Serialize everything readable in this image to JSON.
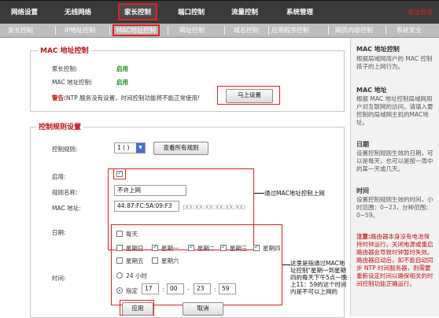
{
  "top_nav": {
    "items": [
      "网络设置",
      "无线网络",
      "家长控制",
      "端口控制",
      "流量控制",
      "系统管理"
    ],
    "logout": "退出登录"
  },
  "sub_nav": {
    "items": [
      "家长控制",
      "IP地址控制",
      "MAC地址控制",
      "网址控制",
      "域名控制",
      "应用程序控制",
      "网页内容控制",
      "系统安全"
    ]
  },
  "mac_section": {
    "legend": "MAC 地址控制",
    "parental_label": "家长控制:",
    "parental_value": "启用",
    "mac_label": "MAC 地址控制:",
    "mac_value": "启用",
    "warning_prefix": "警告:",
    "warning_text": "NTP 服务没有设置，时间控制功能将不能正常使用!",
    "setup_button": "马上设置"
  },
  "rule_section": {
    "legend": "控制规则设置",
    "rule_label": "控制规则:",
    "rule_select": "1 ( )",
    "view_all_button": "查看所有规则",
    "enable_label": "启用:",
    "name_label": "规则名称:",
    "name_value": "不许上网",
    "mac_addr_label": "MAC 地址:",
    "mac_addr_value": "44:87:FC:5A:09:F3",
    "mac_hint": "(XX:XX:XX:XX:XX:XX)",
    "date_label": "日期:",
    "every_day": "每天",
    "days": [
      "星期日",
      "星期一",
      "星期二",
      "星期三",
      "星期四",
      "星期五",
      "星期六"
    ],
    "time_label": "时间:",
    "hours24": "24 小时",
    "specify": "指定",
    "time_from_h": "17",
    "time_from_m": "00",
    "time_to_h": "23",
    "time_to_m": "59",
    "apply_button": "应用",
    "cancel_button": "取消"
  },
  "annotations": {
    "mac_note": "通过MAC地址控制上网",
    "time_note": "这里是指通过MAC地址控制\"星期一到星期四的每天下午5点一晚上11：59的这个时间内是不可以上网的"
  },
  "sidebar": {
    "mac_title": "MAC 地址控制",
    "mac_desc": "根据局域网用户的 MAC 控制孩子的上网行为。",
    "addr_title": "MAC 地址",
    "addr_desc": "根据 MAC 地址控制局域网用户对互联网的访问。请填入要控制的局域网主机的MAC地址。",
    "date_title": "日期",
    "date_desc": "设置控制规则生效的日期，可以是每天，也可以是按一周中的某一天或几天。",
    "time_title": "时间",
    "time_desc": "设置控制规则生效的时间，小时范围：0~23，分种范围：0~59。",
    "note_prefix": "注意:",
    "note_text": "路由器本身没有电池保持时钟运行。关闭电源或重启路由器会导致时钟暂时失效。路由器启动后，如不能自动同步 NTP 时间服务器，则需要重新设定时间以确保相关的时间控制功能正确运行。"
  },
  "colors": {
    "accent": "#c0141a",
    "enabled": "#1d8a18",
    "nav_bg": "#3a3a3a",
    "subnav_bg": "#bdbdbd"
  }
}
